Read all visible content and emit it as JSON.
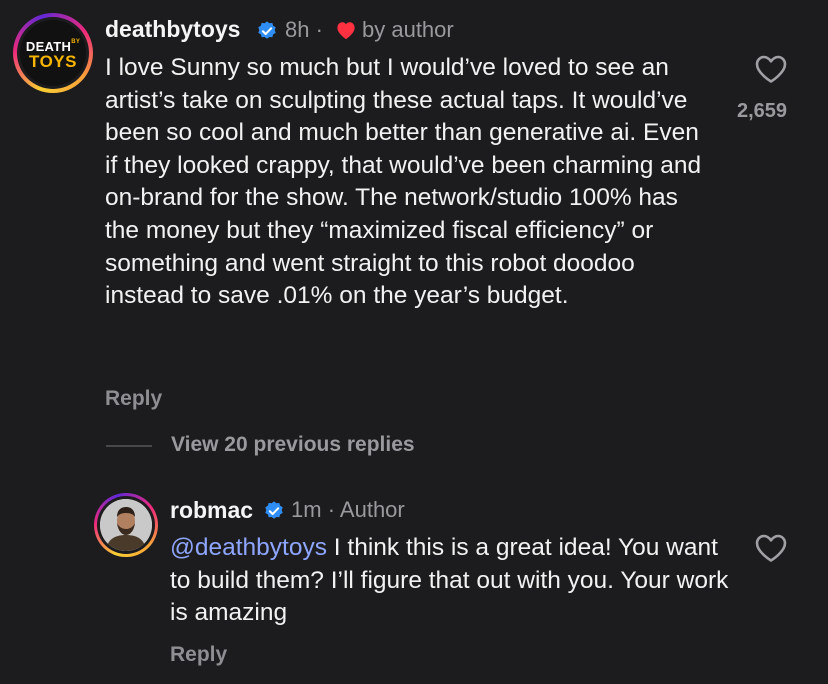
{
  "comment1": {
    "username": "deathbytoys",
    "time": "8h",
    "separator": "·",
    "liked_by": "by author",
    "text": "I love Sunny so much but I would’ve loved to see an artist’s take on sculpting these actual taps. It would’ve been so cool and much better than generative ai. Even if they looked crappy, that would’ve been charming and on-brand for the show. The network/studio 100% has the money but they “maximized fiscal efficiency” or something and went straight to this robot doodoo instead to save .01% on the year’s budget.",
    "reply_label": "Reply",
    "like_count": "2,659",
    "logo_top": "DEATH",
    "logo_by": "BY",
    "logo_bottom": "TOYS"
  },
  "view_replies": "View 20 previous replies",
  "comment2": {
    "username": "robmac",
    "time": "1m",
    "separator": "·",
    "badge": "Author",
    "mention": "@deathbytoys",
    "text": " I think this is a great idea! You want to build them? I’ll figure that out with you. Your work is amazing",
    "reply_label": "Reply"
  },
  "colors": {
    "background": "#1c1c1e",
    "verified": "#2f8ef5",
    "heart": "#ff3040",
    "mention": "#8ea6ff"
  }
}
